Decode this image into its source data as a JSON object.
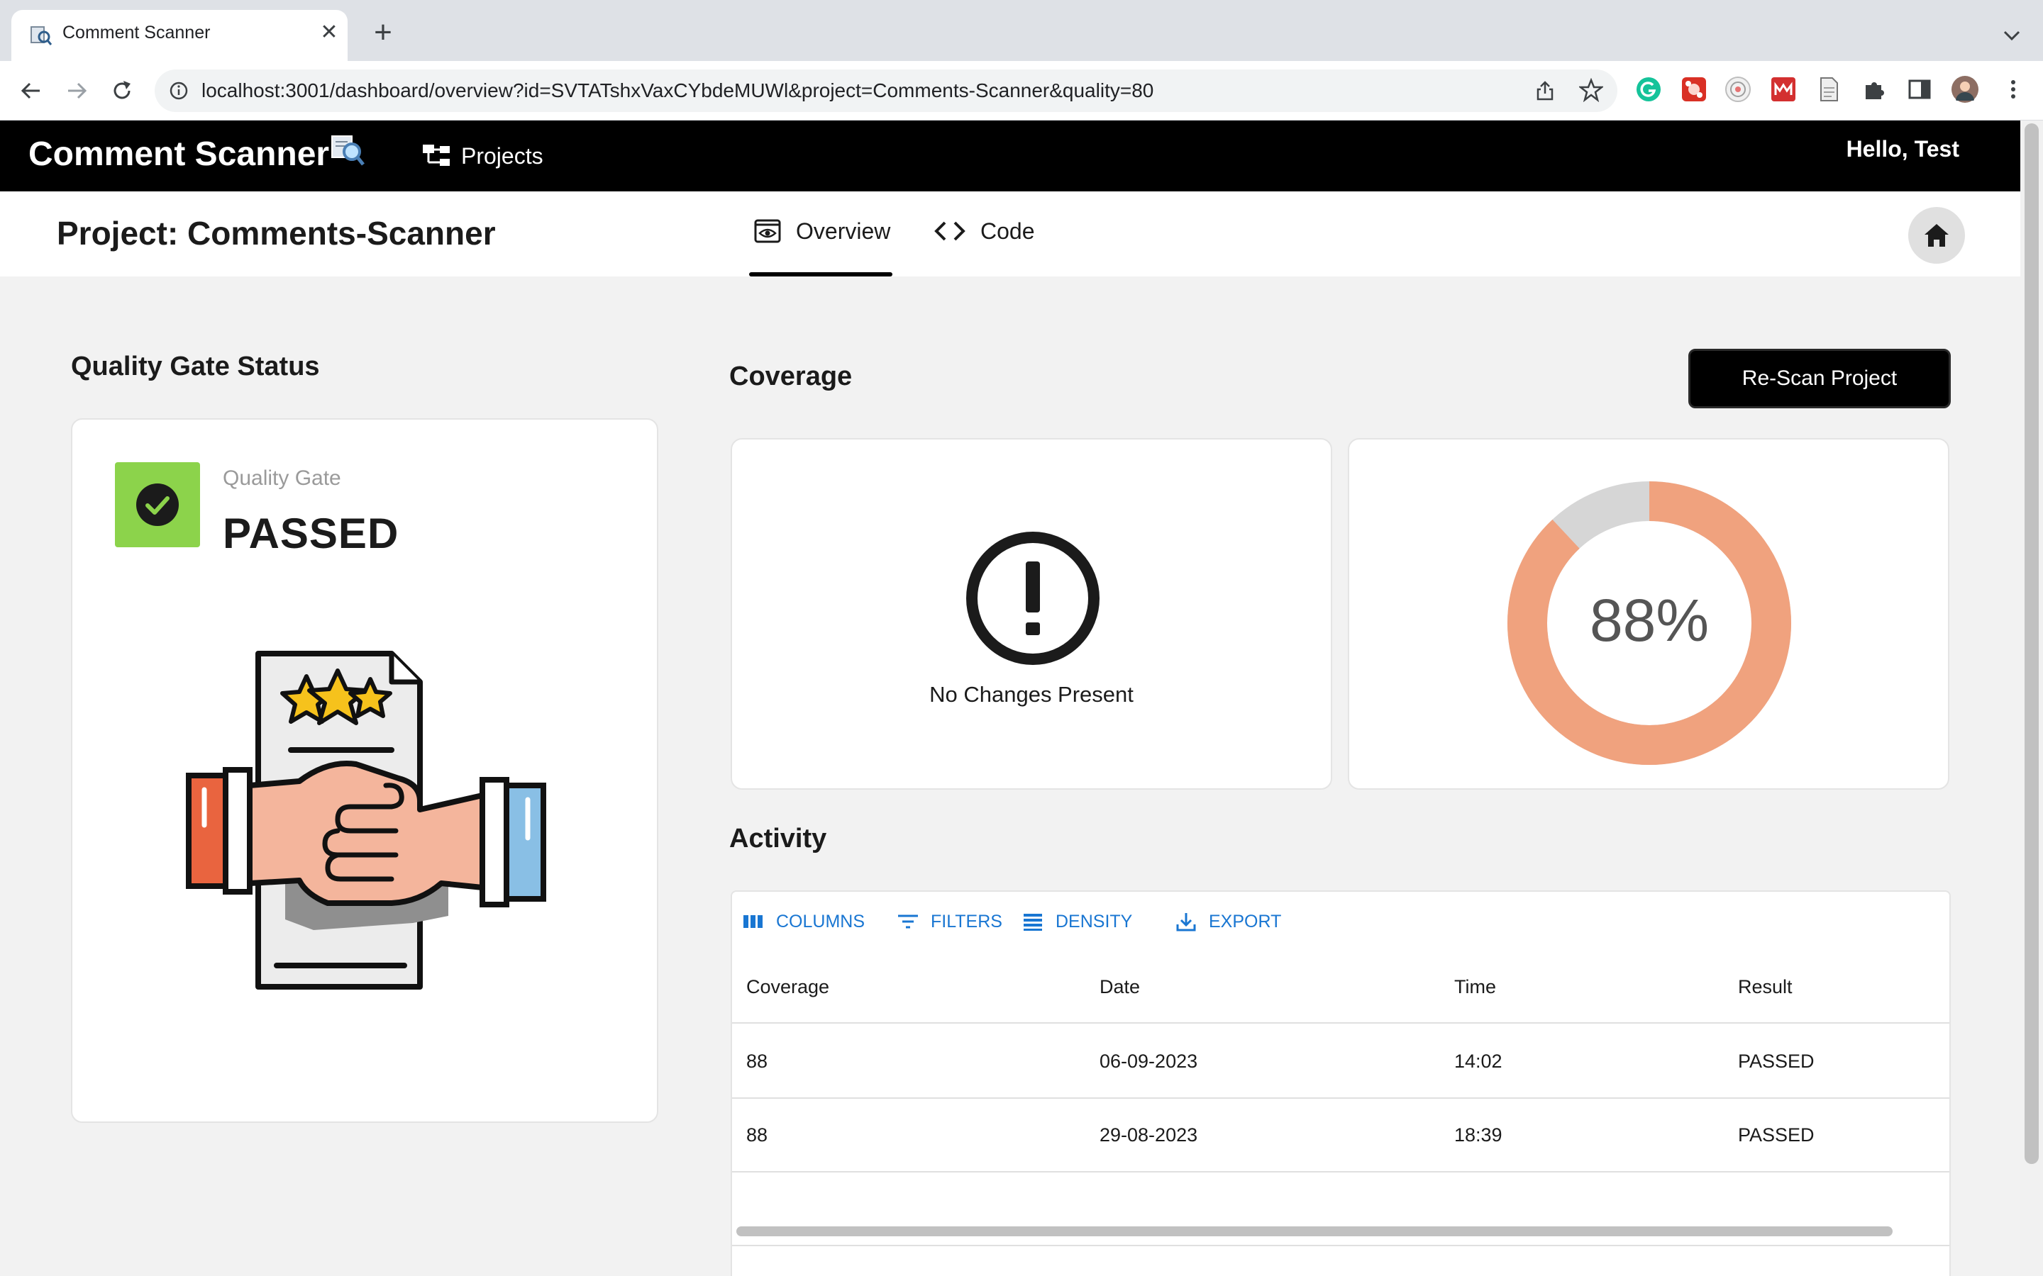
{
  "browser": {
    "tab_title": "Comment Scanner",
    "close_symbol": "✕",
    "new_tab_symbol": "+",
    "url": "localhost:3001/dashboard/overview?id=SVTATshxVaxCYbdeMUWl&project=Comments-Scanner&quality=80",
    "extensions": [
      "grammarly-icon",
      "red-extension-icon",
      "target-extension-icon",
      "mendeley-icon",
      "document-icon",
      "puzzle-icon",
      "sidepanel-icon",
      "avatar"
    ]
  },
  "app": {
    "brand": "Comment Scanner",
    "nav_projects": "Projects",
    "greeting": "Hello, Test"
  },
  "project": {
    "title": "Project: Comments-Scanner",
    "tabs": [
      {
        "label": "Overview",
        "active": true
      },
      {
        "label": "Code",
        "active": false
      }
    ]
  },
  "quality_gate": {
    "heading": "Quality Gate Status",
    "label": "Quality Gate",
    "status": "PASSED",
    "color": "#8cd34b"
  },
  "coverage": {
    "heading": "Coverage",
    "rescan_label": "Re-Scan Project",
    "no_changes_text": "No Changes Present",
    "percent_label": "88%",
    "percent_value": 88,
    "ring_color": "#f0a27e",
    "ring_rest_color": "#d6d6d6"
  },
  "activity": {
    "heading": "Activity",
    "toolbar": {
      "columns": "COLUMNS",
      "filters": "FILTERS",
      "density": "DENSITY",
      "export": "EXPORT"
    },
    "columns": [
      "Coverage",
      "Date",
      "Time",
      "Result"
    ],
    "rows": [
      [
        "88",
        "06-09-2023",
        "14:02",
        "PASSED"
      ],
      [
        "88",
        "29-08-2023",
        "18:39",
        "PASSED"
      ]
    ]
  }
}
